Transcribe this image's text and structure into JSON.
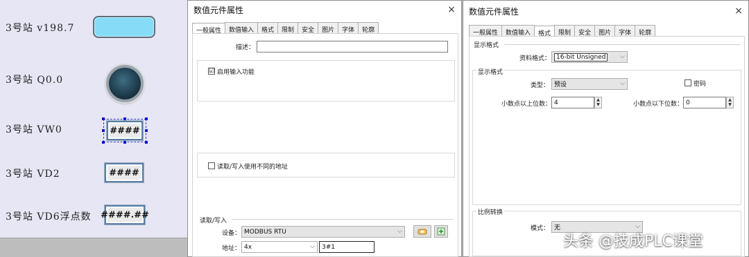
{
  "canvas": {
    "rows": [
      {
        "label": "3号站  v198.7"
      },
      {
        "label": "3号站  Q0.0"
      },
      {
        "label": "3号站  VW0",
        "value": "####"
      },
      {
        "label": "3号站  VD2",
        "value": "####"
      },
      {
        "label": "3号站  VD6浮点数",
        "value": "####.##"
      }
    ]
  },
  "dialog1": {
    "title": "数值元件属性",
    "close": "×",
    "tabs": [
      "一般属性",
      "数值输入",
      "格式",
      "限制",
      "安全",
      "图片",
      "字体",
      "轮廓"
    ],
    "active_tab": "一般属性",
    "desc_label": "描述：",
    "desc_value": "",
    "enable_input_label": "启用输入功能",
    "enable_input_checked": "☑",
    "diff_addr_label": "读取/写入使用不同的地址",
    "rw_group_label": "读取/写入",
    "device_label": "设备：",
    "device_value": "MODBUS RTU",
    "address_label": "地址：",
    "address_type": "4x",
    "address_value": "3#1"
  },
  "dialog2": {
    "title": "数值元件属性",
    "close": "×",
    "tabs": [
      "一般属性",
      "数值输入",
      "格式",
      "限制",
      "安全",
      "图片",
      "字体",
      "轮廓"
    ],
    "active_tab": "格式",
    "display_format_group": "显示格式",
    "data_format_label": "资料格式：",
    "data_format_value": "16-bit Unsigned",
    "display_format_group2": "显示格式",
    "type_label": "类型：",
    "type_value": "预设",
    "password_label": "密码",
    "int_digits_label": "小数点以上位数：",
    "int_digits_value": "4",
    "frac_digits_label": "小数点以下位数：",
    "frac_digits_value": "0",
    "scaling_group": "比例转换",
    "mode_label": "模式：",
    "mode_value": "无"
  },
  "watermark": "头条 @技成PLC课堂",
  "colors": {
    "lamp_field": "#86dcf6",
    "bit_lamp": "#1f3d4e",
    "selection": "#1414c8"
  }
}
